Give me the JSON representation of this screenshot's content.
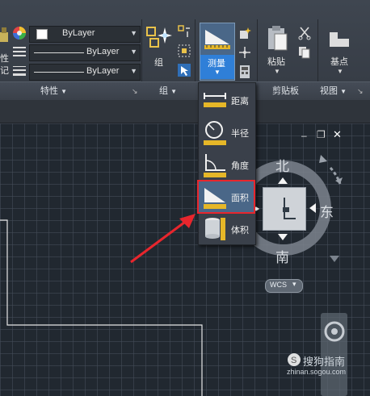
{
  "ribbon": {
    "left_partial": {
      "label_top": "性",
      "label_bottom": "记"
    },
    "properties": {
      "color_value": "ByLayer",
      "linetype_value": "ByLayer",
      "lineweight_value": "ByLayer",
      "panel_title": "特性"
    },
    "groups": {
      "group_button_label": "组",
      "panel_title": "组"
    },
    "utilities": {
      "measure_label": "测量",
      "measure_menu": [
        {
          "label": "距离",
          "icon": "distance-icon"
        },
        {
          "label": "半径",
          "icon": "radius-icon"
        },
        {
          "label": "角度",
          "icon": "angle-icon"
        },
        {
          "label": "面积",
          "icon": "area-icon",
          "highlighted": true
        },
        {
          "label": "体积",
          "icon": "volume-icon"
        }
      ]
    },
    "clipboard": {
      "paste_label": "粘贴",
      "panel_title": "剪贴板"
    },
    "view": {
      "base_label": "基点",
      "panel_title": "视图"
    }
  },
  "viewcube": {
    "north": "北",
    "south": "南",
    "east": "东",
    "wcs_label": "WCS"
  },
  "watermark": {
    "brand": "搜狗指南",
    "url": "zhinan.sogou.com"
  },
  "colors": {
    "highlight_border": "#e8262d",
    "arrow": "#e8262d",
    "accent_blue": "#2f7fd8"
  }
}
